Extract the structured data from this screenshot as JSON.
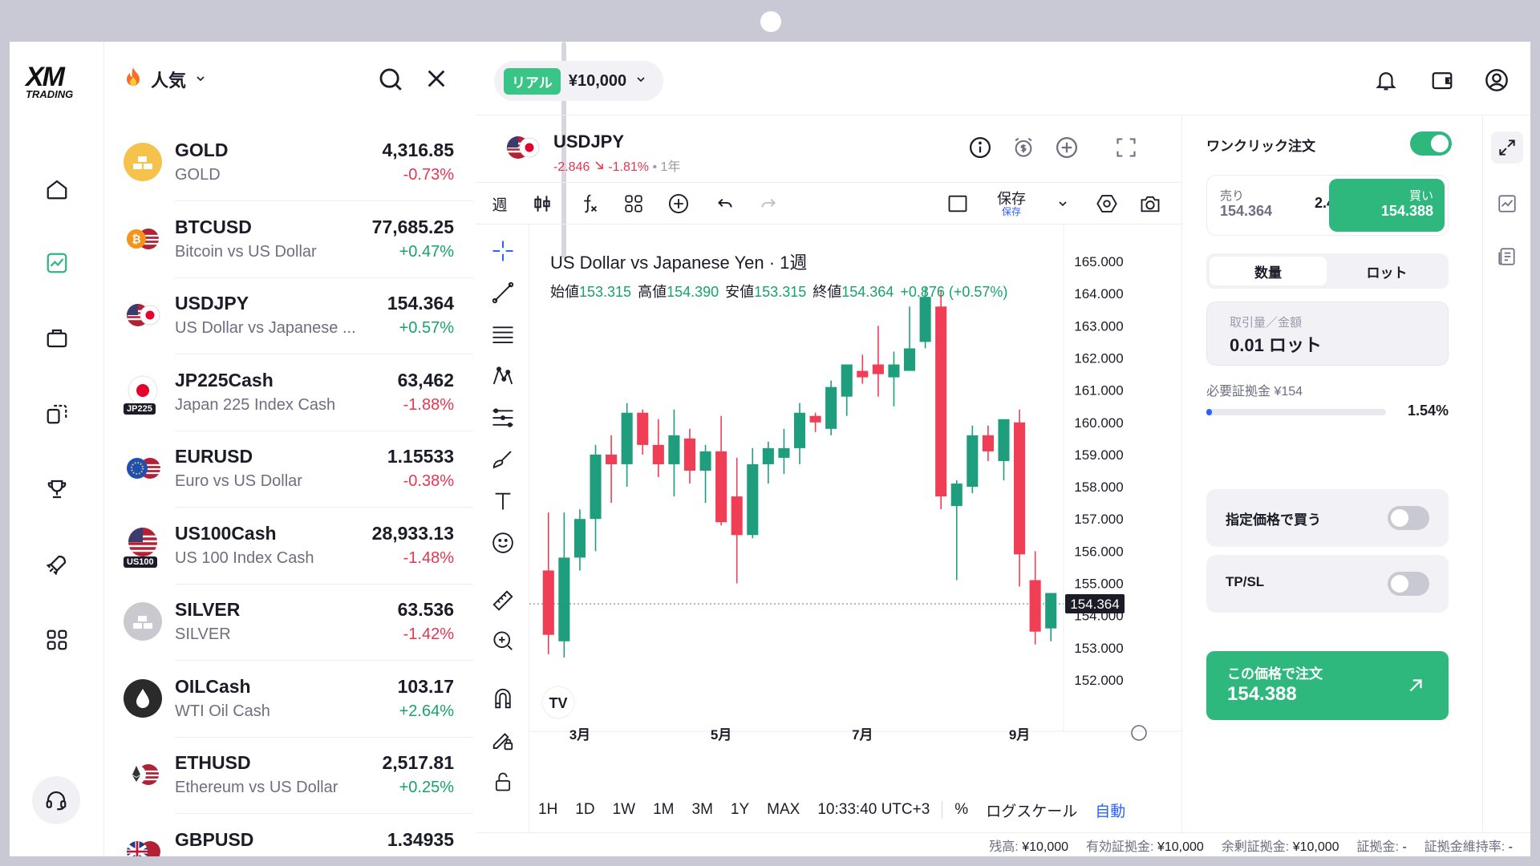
{
  "brand": {
    "logo_top": "XM",
    "logo_bottom": "TRADING"
  },
  "watchlist": {
    "filter_label": "人気",
    "items": [
      {
        "symbol": "GOLD",
        "desc": "GOLD",
        "price": "4,316.85",
        "change": "-0.73%",
        "dir": "neg",
        "icon": "gold-bars-icon"
      },
      {
        "symbol": "BTCUSD",
        "desc": "Bitcoin vs US Dollar",
        "price": "77,685.25",
        "change": "+0.47%",
        "dir": "pos",
        "icon": "bitcoin-usd-flag-icon"
      },
      {
        "symbol": "USDJPY",
        "desc": "US Dollar vs Japanese ...",
        "price": "154.364",
        "change": "+0.57%",
        "dir": "pos",
        "icon": "us-jp-flag-icon"
      },
      {
        "symbol": "JP225Cash",
        "desc": "Japan 225 Index Cash",
        "price": "63,462",
        "change": "-1.88%",
        "dir": "neg",
        "icon": "jp-flag-icon",
        "tag": "JP225"
      },
      {
        "symbol": "EURUSD",
        "desc": "Euro vs US Dollar",
        "price": "1.15533",
        "change": "-0.38%",
        "dir": "neg",
        "icon": "eu-us-flag-icon"
      },
      {
        "symbol": "US100Cash",
        "desc": "US 100 Index Cash",
        "price": "28,933.13",
        "change": "-1.48%",
        "dir": "neg",
        "icon": "us-flag-icon",
        "tag": "US100"
      },
      {
        "symbol": "SILVER",
        "desc": "SILVER",
        "price": "63.536",
        "change": "-1.42%",
        "dir": "neg",
        "icon": "silver-bars-icon"
      },
      {
        "symbol": "OILCash",
        "desc": "WTI Oil Cash",
        "price": "103.17",
        "change": "+2.64%",
        "dir": "pos",
        "icon": "oil-drop-icon"
      },
      {
        "symbol": "ETHUSD",
        "desc": "Ethereum vs US Dollar",
        "price": "2,517.81",
        "change": "+0.25%",
        "dir": "pos",
        "icon": "ethereum-usd-flag-icon"
      },
      {
        "symbol": "GBPUSD",
        "desc": "",
        "price": "1.34935",
        "change": "",
        "dir": "neg",
        "icon": "gb-us-flag-icon"
      }
    ]
  },
  "account": {
    "type": "リアル",
    "balance": "¥10,000"
  },
  "symbol_header": {
    "symbol": "USDJPY",
    "change": "-2.846",
    "change_pct": "-1.81%",
    "timeframe": "1年"
  },
  "toolbar": {
    "interval": "週",
    "save_label": "保存",
    "save_sub": "保存"
  },
  "legend": {
    "title": "US Dollar vs Japanese Yen · 1週",
    "open_label": "始値",
    "open": "153.315",
    "high_label": "高値",
    "high": "154.390",
    "low_label": "安値",
    "low": "153.315",
    "close_label": "終値",
    "close": "154.364",
    "change": "+0.876 (+0.57%)"
  },
  "chart_data": {
    "type": "candlestick",
    "x_labels": [
      "3月",
      "5月",
      "7月",
      "9月"
    ],
    "y_ticks": [
      152,
      153,
      154,
      155,
      156,
      157,
      158,
      159,
      160,
      161,
      162,
      163,
      164,
      165
    ],
    "ylim": [
      151.5,
      165.4
    ],
    "last_price": "154.364",
    "candles": [
      [
        155.4,
        157.2,
        152.8,
        153.4
      ],
      [
        153.2,
        157.2,
        152.7,
        155.8
      ],
      [
        155.8,
        157.3,
        155.4,
        157.0
      ],
      [
        157.0,
        159.3,
        156.0,
        159.0
      ],
      [
        159.0,
        159.6,
        157.5,
        158.7
      ],
      [
        158.7,
        160.6,
        158.0,
        160.3
      ],
      [
        160.3,
        160.4,
        159.0,
        159.3
      ],
      [
        159.3,
        160.1,
        158.3,
        158.7
      ],
      [
        158.7,
        160.4,
        157.7,
        159.6
      ],
      [
        159.5,
        159.8,
        158.1,
        158.5
      ],
      [
        158.5,
        159.3,
        157.5,
        159.1
      ],
      [
        159.1,
        160.2,
        156.8,
        156.9
      ],
      [
        157.7,
        158.9,
        155.0,
        156.5
      ],
      [
        156.5,
        159.2,
        156.4,
        158.7
      ],
      [
        158.7,
        159.4,
        158.1,
        159.2
      ],
      [
        158.9,
        159.8,
        158.4,
        159.2
      ],
      [
        159.2,
        160.6,
        158.7,
        160.3
      ],
      [
        160.2,
        160.3,
        159.7,
        160.0
      ],
      [
        159.8,
        161.3,
        159.6,
        161.1
      ],
      [
        160.8,
        161.4,
        160.2,
        161.8
      ],
      [
        161.6,
        162.1,
        161.2,
        161.4
      ],
      [
        161.8,
        163.0,
        160.8,
        161.5
      ],
      [
        161.4,
        162.2,
        160.5,
        161.8
      ],
      [
        161.6,
        163.6,
        161.6,
        162.3
      ],
      [
        162.5,
        164.2,
        162.3,
        163.9
      ],
      [
        163.6,
        164.1,
        157.3,
        157.7
      ],
      [
        157.4,
        158.2,
        155.1,
        158.1
      ],
      [
        158.0,
        159.9,
        157.8,
        159.6
      ],
      [
        159.6,
        159.9,
        158.8,
        159.1
      ],
      [
        158.8,
        160.1,
        158.2,
        160.1
      ],
      [
        160.0,
        160.4,
        154.9,
        155.9
      ],
      [
        155.1,
        156.0,
        153.1,
        153.5
      ],
      [
        153.6,
        154.6,
        153.2,
        154.7
      ]
    ]
  },
  "range_bar": {
    "ranges": [
      "1H",
      "1D",
      "1W",
      "1M",
      "3M",
      "1Y",
      "MAX"
    ],
    "time": "10:33:40 UTC+3",
    "percent": "%",
    "log": "ログスケール",
    "auto": "自動"
  },
  "order": {
    "one_click_label": "ワンクリック注文",
    "one_click_on": true,
    "sell_label": "売り",
    "sell_price": "154.364",
    "spread": "2.4",
    "buy_label": "買い",
    "buy_price": "154.388",
    "seg_qty": "数量",
    "seg_lot": "ロット",
    "qty_label": "取引量／金額",
    "qty_value": "0.01 ロット",
    "margin_label": "必要証拠金 ¥154",
    "margin_pct": "1.54%",
    "margin_fraction": 0.0154,
    "limit_label": "指定価格で買う",
    "tpsl_label": "TP/SL",
    "cta_label": "この価格で注文",
    "cta_price": "154.388"
  },
  "status": {
    "balance_label": "残高:",
    "balance": "¥10,000",
    "equity_label": "有効証拠金:",
    "equity": "¥10,000",
    "free_label": "余剰証拠金:",
    "free": "¥10,000",
    "margin_label": "証拠金:",
    "margin": "-",
    "level_label": "証拠金維持率:",
    "level": "-"
  },
  "colors": {
    "up": "#1f9e7d",
    "down": "#ef3e55",
    "accent": "#2fb87e",
    "link": "#2962ff"
  }
}
